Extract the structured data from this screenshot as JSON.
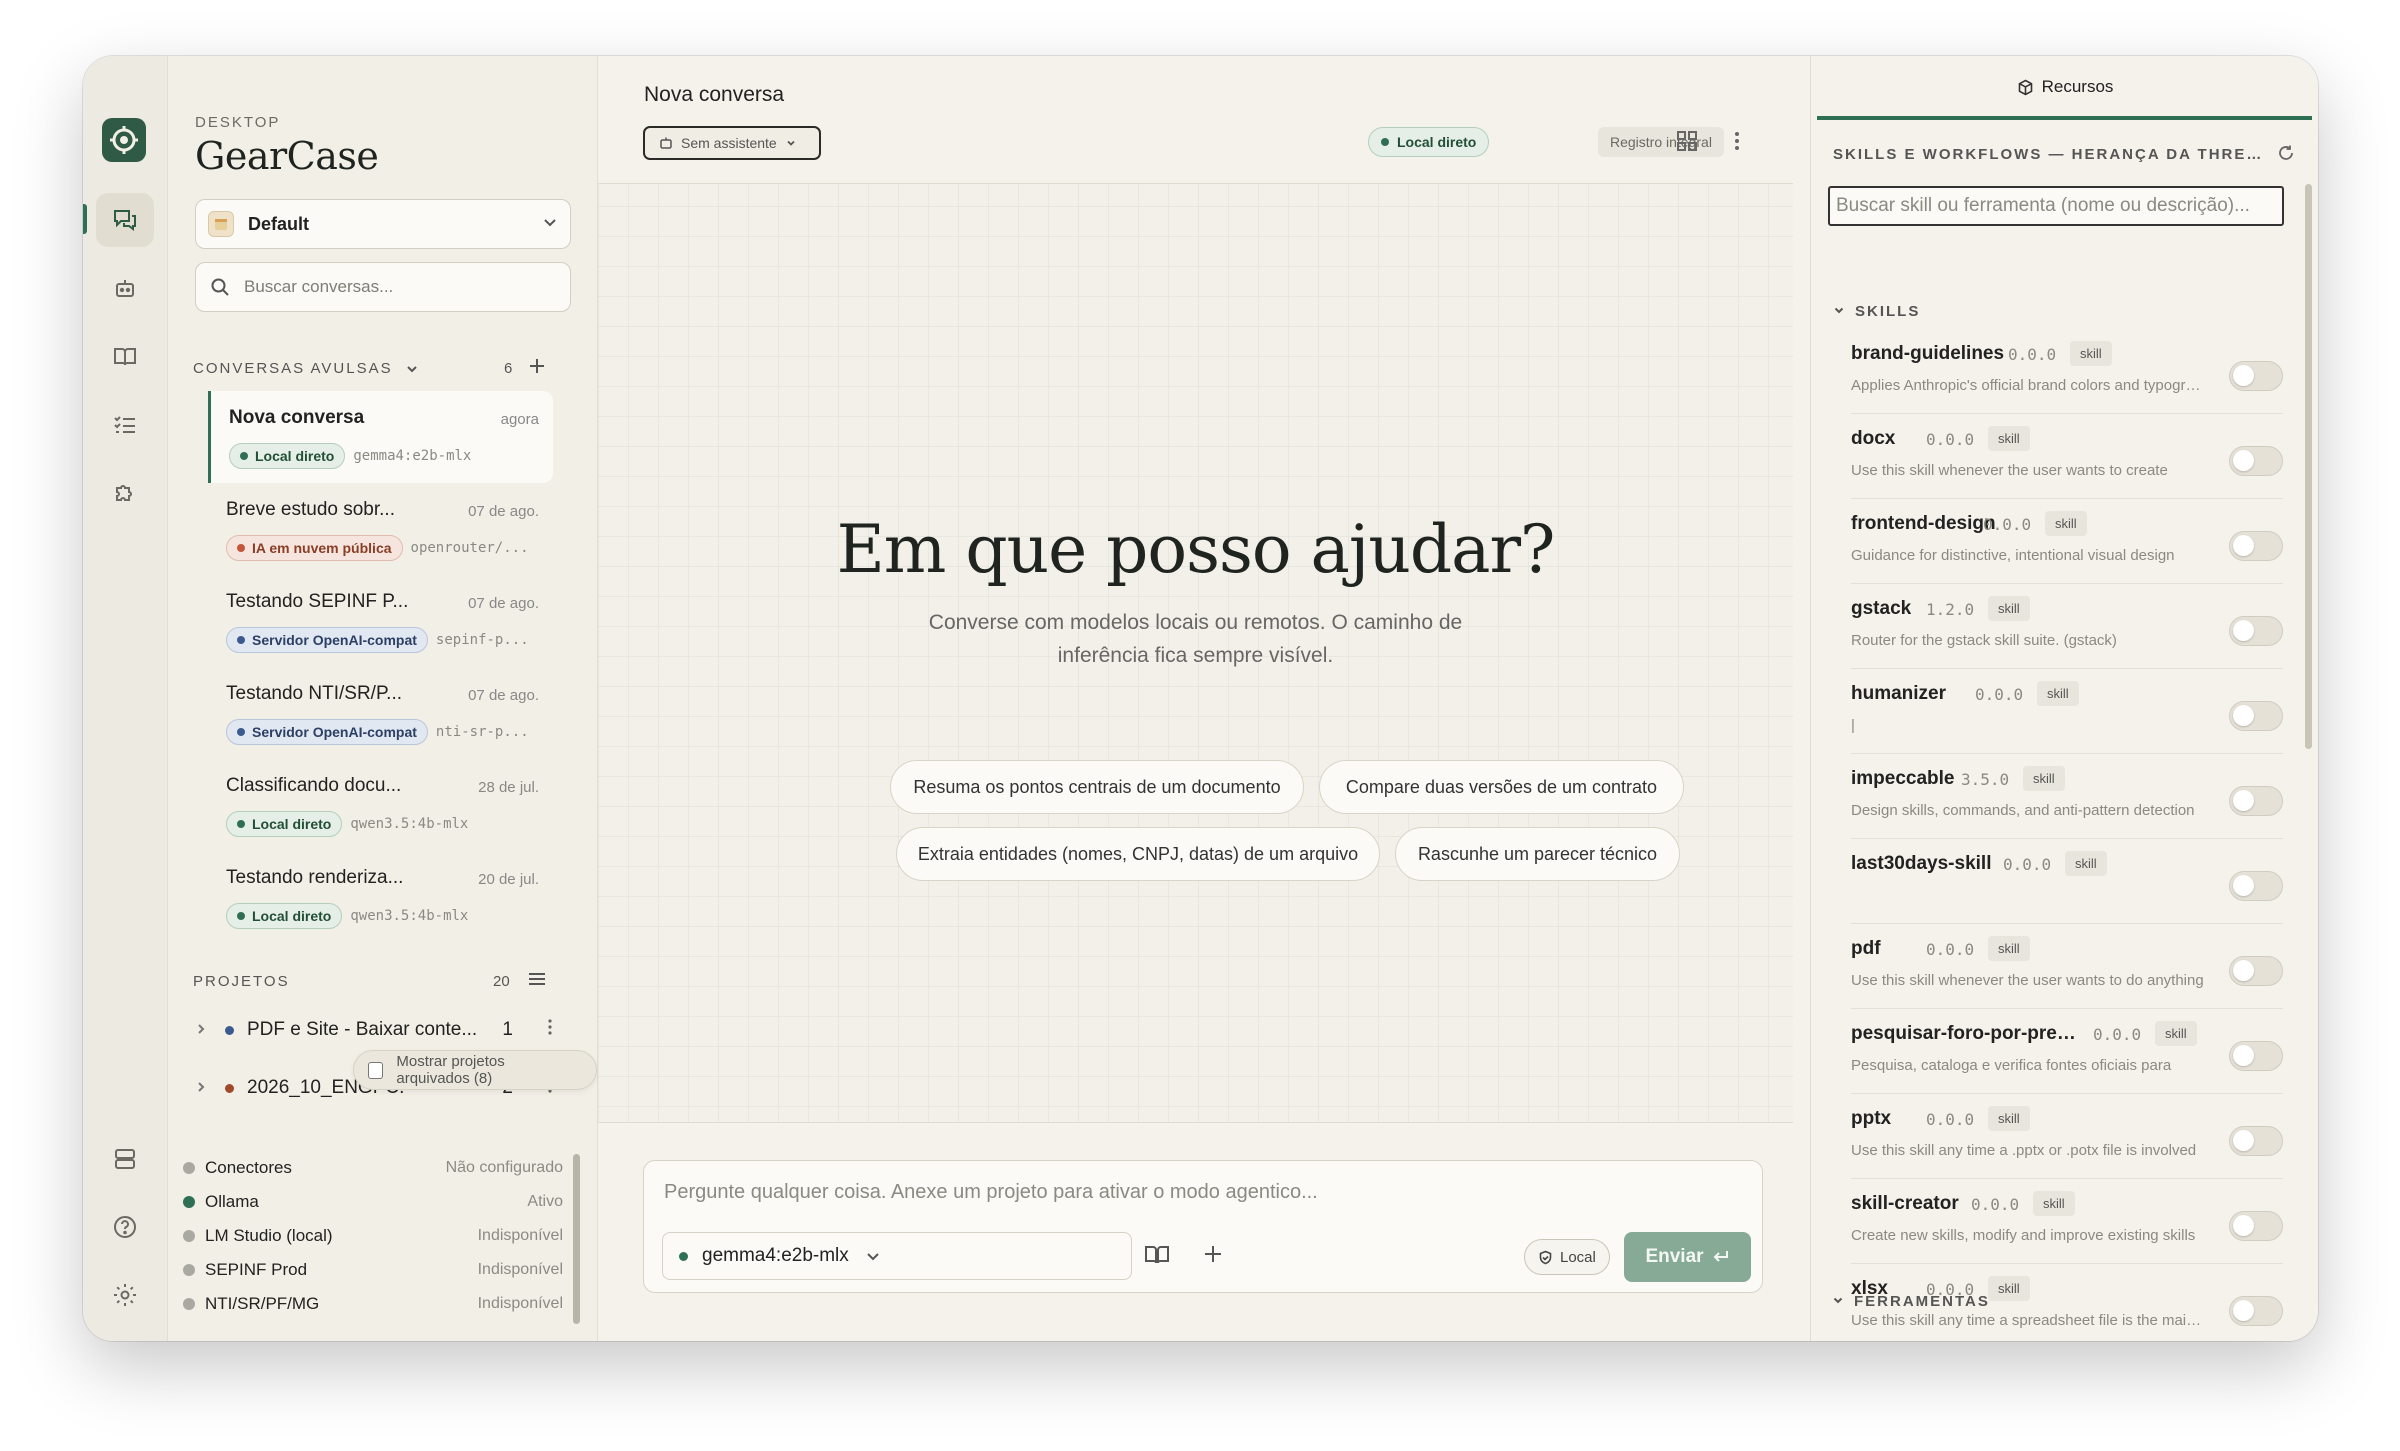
{
  "app": {
    "kicker": "DESKTOP",
    "title": "GearCase"
  },
  "workspace": {
    "label": "Default"
  },
  "conv_search": {
    "placeholder": "Buscar conversas..."
  },
  "conversations": {
    "heading": "CONVERSAS AVULSAS",
    "count": "6",
    "items": [
      {
        "title": "Nova conversa",
        "time": "agora",
        "badge": "Local direto",
        "badge_type": "local",
        "model": "gemma4:e2b-mlx"
      },
      {
        "title": "Breve estudo sobr...",
        "time": "07 de ago.",
        "badge": "IA em nuvem pública",
        "badge_type": "cloud",
        "model": "openrouter/..."
      },
      {
        "title": "Testando SEPINF P...",
        "time": "07 de ago.",
        "badge": "Servidor OpenAI-compat",
        "badge_type": "server",
        "model": "sepinf-p..."
      },
      {
        "title": "Testando NTI/SR/P...",
        "time": "07 de ago.",
        "badge": "Servidor OpenAI-compat",
        "badge_type": "server",
        "model": "nti-sr-p..."
      },
      {
        "title": "Classificando docu...",
        "time": "28 de jul.",
        "badge": "Local direto",
        "badge_type": "local",
        "model": "qwen3.5:4b-mlx"
      },
      {
        "title": "Testando renderiza...",
        "time": "20 de jul.",
        "badge": "Local direto",
        "badge_type": "local",
        "model": "qwen3.5:4b-mlx"
      }
    ]
  },
  "projects": {
    "heading": "PROJETOS",
    "count": "20",
    "items": [
      {
        "name": "PDF e Site - Baixar conte...",
        "count": "1",
        "color": "#3b5a8f"
      },
      {
        "name": "2026_10_ENGPC.",
        "count": "2",
        "color": "#a04a2a"
      }
    ],
    "archived_label": "Mostrar projetos arquivados (8)"
  },
  "providers": [
    {
      "name": "Conectores",
      "status": "Não configurado",
      "on": false
    },
    {
      "name": "Ollama",
      "status": "Ativo",
      "on": true
    },
    {
      "name": "LM Studio (local)",
      "status": "Indisponível",
      "on": false
    },
    {
      "name": "SEPINF Prod",
      "status": "Indisponível",
      "on": false
    },
    {
      "name": "NTI/SR/PF/MG",
      "status": "Indisponível",
      "on": false
    }
  ],
  "main": {
    "title": "Nova conversa",
    "assistant_label": "Sem assistente",
    "badge_local": "Local direto",
    "badge_registry": "Registro integral",
    "hero_title": "Em que posso ajudar?",
    "hero_sub_1": "Converse com modelos locais ou remotos. O caminho de",
    "hero_sub_2": "inferência fica sempre visível.",
    "suggestions": [
      "Resuma os pontos centrais de um documento",
      "Compare duas versões de um contrato",
      "Extraia entidades (nomes, CNPJ, datas) de um arquivo",
      "Rascunhe um parecer técnico"
    ],
    "composer_placeholder": "Pergunte qualquer coisa. Anexe um projeto para ativar o modo agentico...",
    "model": "gemma4:e2b-mlx",
    "local_pill": "Local",
    "send_label": "Enviar"
  },
  "resources": {
    "tab": "Recursos",
    "heading": "SKILLS E WORKFLOWS — HERANÇA DA THREAD",
    "search_placeholder": "Buscar skill ou ferramenta (nome ou descrição)...",
    "skills_heading": "SKILLS",
    "tools_heading": "FERRAMENTAS",
    "skills": [
      {
        "name": "brand-guidelines",
        "version": "0.0.0",
        "tag": "skill",
        "desc": "Applies Anthropic's official brand colors and typography"
      },
      {
        "name": "docx",
        "version": "0.0.0",
        "tag": "skill",
        "desc": "Use this skill whenever the user wants to create"
      },
      {
        "name": "frontend-design",
        "version": "0.0.0",
        "tag": "skill",
        "desc": "Guidance for distinctive, intentional visual design"
      },
      {
        "name": "gstack",
        "version": "1.2.0",
        "tag": "skill",
        "desc": "Router for the gstack skill suite. (gstack)"
      },
      {
        "name": "humanizer",
        "version": "0.0.0",
        "tag": "skill",
        "desc": "|"
      },
      {
        "name": "impeccable",
        "version": "3.5.0",
        "tag": "skill",
        "desc": "Design skills, commands, and anti-pattern detection"
      },
      {
        "name": "last30days-skill",
        "version": "0.0.0",
        "tag": "skill",
        "desc": ""
      },
      {
        "name": "pdf",
        "version": "0.0.0",
        "tag": "skill",
        "desc": "Use this skill whenever the user wants to do anything"
      },
      {
        "name": "pesquisar-foro-por-prerr...",
        "version": "0.0.0",
        "tag": "skill",
        "desc": "Pesquisa, cataloga e verifica fontes oficiais para"
      },
      {
        "name": "pptx",
        "version": "0.0.0",
        "tag": "skill",
        "desc": "Use this skill any time a .pptx or .potx file is involved"
      },
      {
        "name": "skill-creator",
        "version": "0.0.0",
        "tag": "skill",
        "desc": "Create new skills, modify and improve existing skills"
      },
      {
        "name": "xlsx",
        "version": "0.0.0",
        "tag": "skill",
        "desc": "Use this skill any time a spreadsheet file is the main input"
      }
    ]
  }
}
